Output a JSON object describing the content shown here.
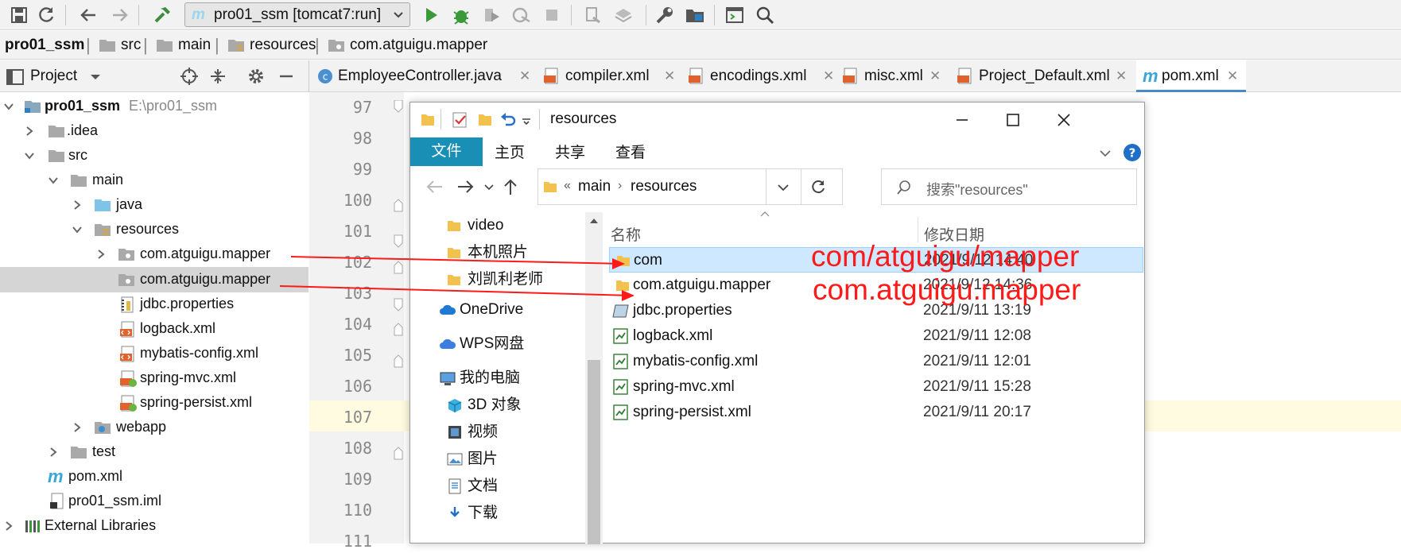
{
  "toolbar": {
    "run_config": "pro01_ssm [tomcat7:run]"
  },
  "breadcrumb": [
    "pro01_ssm",
    "src",
    "main",
    "resources",
    "com.atguigu.mapper"
  ],
  "project_panel": {
    "title": "Project"
  },
  "tree": {
    "root_name": "pro01_ssm",
    "root_path": "E:\\pro01_ssm",
    "items": [
      ".idea",
      "src",
      "main",
      "java",
      "resources",
      "com.atguigu.mapper",
      "com.atguigu.mapper",
      "jdbc.properties",
      "logback.xml",
      "mybatis-config.xml",
      "spring-mvc.xml",
      "spring-persist.xml",
      "webapp",
      "test",
      "pom.xml",
      "pro01_ssm.iml",
      "External Libraries"
    ]
  },
  "tabs": [
    "EmployeeController.java",
    "compiler.xml",
    "encodings.xml",
    "misc.xml",
    "Project_Default.xml",
    "pom.xml"
  ],
  "gutter": [
    "97",
    "98",
    "99",
    "100",
    "101",
    "102",
    "103",
    "104",
    "105",
    "106",
    "107",
    "108",
    "109",
    "110",
    "111"
  ],
  "explorer": {
    "title": "resources",
    "ribbon": [
      "文件",
      "主页",
      "共享",
      "查看"
    ],
    "address": {
      "prefix": "«",
      "parts": [
        "main",
        "resources"
      ]
    },
    "search_placeholder": "搜索\"resources\"",
    "nav": [
      "video",
      "本机照片",
      "刘凯利老师",
      "OneDrive",
      "WPS网盘",
      "我的电脑",
      "3D 对象",
      "视频",
      "图片",
      "文档",
      "下载"
    ],
    "col_name": "名称",
    "col_date": "修改日期",
    "files": [
      {
        "name": "com",
        "date": "2021/9/12 14:40"
      },
      {
        "name": "com.atguigu.mapper",
        "date": "2021/9/12 14:36"
      },
      {
        "name": "jdbc.properties",
        "date": "2021/9/11 13:19"
      },
      {
        "name": "logback.xml",
        "date": "2021/9/11 12:08"
      },
      {
        "name": "mybatis-config.xml",
        "date": "2021/9/11 12:01"
      },
      {
        "name": "spring-mvc.xml",
        "date": "2021/9/11 15:28"
      },
      {
        "name": "spring-persist.xml",
        "date": "2021/9/11 20:17"
      }
    ]
  },
  "annotations": [
    "com/atguigu/mapper",
    "com.atguigu.mapper"
  ],
  "colors": {
    "ribbon_file_tab": "#1a8fb5",
    "selection": "#cde8ff",
    "tree_selection": "#d5d5d5",
    "annotation": "#ff1a1a"
  }
}
